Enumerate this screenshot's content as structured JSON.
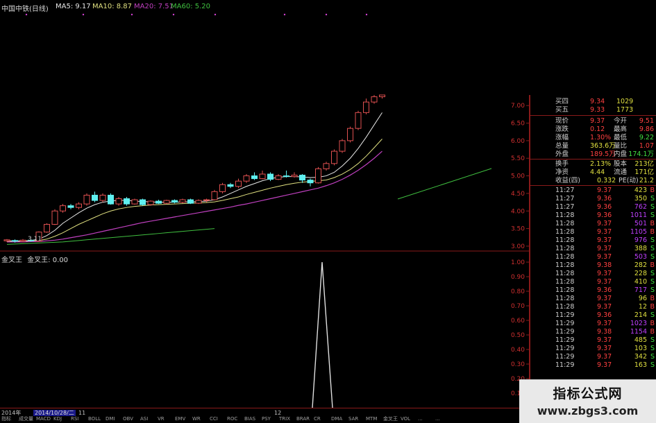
{
  "header": {
    "stock_name": "中国中铁(日线)",
    "ma5": "MA5: 9.17",
    "ma10": "MA10: 8.87",
    "ma20": "MA20: 7.51",
    "ma60": "MA60: 5.20"
  },
  "indicator": {
    "label1": "金叉王",
    "label2": "金叉王: 0.00"
  },
  "axis": {
    "price_ticks": [
      "7.00",
      "6.50",
      "6.00",
      "5.50",
      "5.00",
      "4.50",
      "4.00",
      "3.50",
      "3.00"
    ],
    "ind_ticks": [
      "1.00",
      "0.90",
      "0.80",
      "0.70",
      "0.60",
      "0.50",
      "0.40",
      "0.30",
      "0.20",
      "0.10"
    ],
    "low_price_label": "3.11"
  },
  "bottom": {
    "year_tab": "2014年",
    "date_tab": "2014/10/28/二",
    "marker_a": "11",
    "marker_b": "12",
    "tabs": [
      "指标",
      "成交量",
      "MACD",
      "KDJ",
      "RSI",
      "BOLL",
      "DMI",
      "OBV",
      "ASI",
      "VR",
      "EMV",
      "WR",
      "CCI",
      "ROC",
      "BIAS",
      "PSY",
      "TRIX",
      "BRAR",
      "CR",
      "DMA",
      "SAR",
      "MTM",
      "金叉王",
      "VOL",
      "...",
      "..."
    ]
  },
  "quote_panel": {
    "buy_levels": [
      {
        "label": "买四",
        "price": "9.34",
        "volume": "1029"
      },
      {
        "label": "买五",
        "price": "9.33",
        "volume": "1773"
      }
    ],
    "stats": [
      {
        "l1": "现价",
        "v1": "9.37",
        "l2": "今开",
        "v2": "9.51"
      },
      {
        "l1": "涨跌",
        "v1": "0.12",
        "l2": "最高",
        "v2": "9.86"
      },
      {
        "l1": "涨幅",
        "v1": "1.30%",
        "l2": "最低",
        "v2": "9.22"
      },
      {
        "l1": "总量",
        "v1": "363.6万",
        "l2": "量比",
        "v2": "1.07"
      },
      {
        "l1": "外盘",
        "v1": "189.5万",
        "l2": "内盘",
        "v2": "174.1万"
      },
      {
        "l1": "换手",
        "v1": "2.13%",
        "l2": "股本",
        "v2": "213亿"
      },
      {
        "l1": "净资",
        "v1": "4.44",
        "l2": "流通",
        "v2": "171亿"
      },
      {
        "l1": "收益(四)",
        "v1": "0.332",
        "l2": "PE(动)",
        "v2": "21.2"
      }
    ],
    "trades": [
      {
        "time": "11:27",
        "price": "9.37",
        "vol": "423",
        "side": "B"
      },
      {
        "time": "11:27",
        "price": "9.36",
        "vol": "350",
        "side": "S"
      },
      {
        "time": "11:27",
        "price": "9.36",
        "vol": "762",
        "side": "S"
      },
      {
        "time": "11:28",
        "price": "9.36",
        "vol": "1011",
        "side": "S"
      },
      {
        "time": "11:28",
        "price": "9.37",
        "vol": "501",
        "side": "B"
      },
      {
        "time": "11:28",
        "price": "9.37",
        "vol": "1105",
        "side": "B"
      },
      {
        "time": "11:28",
        "price": "9.37",
        "vol": "976",
        "side": "S"
      },
      {
        "time": "11:28",
        "price": "9.37",
        "vol": "388",
        "side": "S"
      },
      {
        "time": "11:28",
        "price": "9.37",
        "vol": "503",
        "side": "S"
      },
      {
        "time": "11:28",
        "price": "9.38",
        "vol": "282",
        "side": "B"
      },
      {
        "time": "11:28",
        "price": "9.37",
        "vol": "228",
        "side": "S"
      },
      {
        "time": "11:28",
        "price": "9.37",
        "vol": "410",
        "side": "S"
      },
      {
        "time": "11:28",
        "price": "9.36",
        "vol": "717",
        "side": "S"
      },
      {
        "time": "11:28",
        "price": "9.37",
        "vol": "96",
        "side": "B"
      },
      {
        "time": "11:28",
        "price": "9.37",
        "vol": "12",
        "side": "B"
      },
      {
        "time": "11:29",
        "price": "9.36",
        "vol": "214",
        "side": "S"
      },
      {
        "time": "11:29",
        "price": "9.37",
        "vol": "1023",
        "side": "B"
      },
      {
        "time": "11:29",
        "price": "9.38",
        "vol": "1154",
        "side": "B"
      },
      {
        "time": "11:29",
        "price": "9.37",
        "vol": "485",
        "side": "S"
      },
      {
        "time": "11:29",
        "price": "9.37",
        "vol": "103",
        "side": "S"
      },
      {
        "time": "11:29",
        "price": "9.37",
        "vol": "342",
        "side": "S"
      },
      {
        "time": "11:29",
        "price": "9.37",
        "vol": "163",
        "side": "S"
      }
    ]
  },
  "watermark": {
    "line1": "指标公式网",
    "line2": "www.zbgs3.com"
  },
  "colors": {
    "up": "#e05050",
    "down": "#5ff0f0",
    "ma5": "#e8e8e8",
    "ma10": "#e0e080",
    "ma20": "#c040c0",
    "ma60": "#40c040",
    "panel_border": "#8a1a1a",
    "value_red": "#ff4040",
    "value_yellow": "#e0e040",
    "value_green": "#40e040",
    "value_purple": "#c040ff",
    "label_text": "#d0d0d0"
  },
  "chart_data": {
    "type": "candlestick",
    "ylim": [
      2.9,
      7.3
    ],
    "candles": [
      [
        3.15,
        3.18,
        3.12,
        3.2
      ],
      [
        3.16,
        3.14,
        3.1,
        3.19
      ],
      [
        3.14,
        3.17,
        3.11,
        3.2
      ],
      [
        3.17,
        3.15,
        3.13,
        3.19
      ],
      [
        3.14,
        3.4,
        3.12,
        3.42
      ],
      [
        3.4,
        3.62,
        3.38,
        3.65
      ],
      [
        3.62,
        4.0,
        3.6,
        4.05
      ],
      [
        4.0,
        4.15,
        3.95,
        4.2
      ],
      [
        4.15,
        4.1,
        4.05,
        4.2
      ],
      [
        4.1,
        4.2,
        4.05,
        4.25
      ],
      [
        4.2,
        4.45,
        4.15,
        4.5
      ],
      [
        4.45,
        4.3,
        4.25,
        4.55
      ],
      [
        4.3,
        4.45,
        4.25,
        4.5
      ],
      [
        4.45,
        4.2,
        4.18,
        4.5
      ],
      [
        4.2,
        4.35,
        4.15,
        4.4
      ],
      [
        4.35,
        4.2,
        4.15,
        4.4
      ],
      [
        4.2,
        4.32,
        4.18,
        4.35
      ],
      [
        4.32,
        4.18,
        4.15,
        4.35
      ],
      [
        4.18,
        4.28,
        4.15,
        4.3
      ],
      [
        4.28,
        4.22,
        4.2,
        4.32
      ],
      [
        4.22,
        4.3,
        4.2,
        4.32
      ],
      [
        4.3,
        4.25,
        4.22,
        4.33
      ],
      [
        4.25,
        4.32,
        4.22,
        4.35
      ],
      [
        4.32,
        4.22,
        4.2,
        4.35
      ],
      [
        4.22,
        4.3,
        4.2,
        4.33
      ],
      [
        4.3,
        4.32,
        4.25,
        4.35
      ],
      [
        4.32,
        4.55,
        4.3,
        4.6
      ],
      [
        4.55,
        4.75,
        4.5,
        4.8
      ],
      [
        4.75,
        4.7,
        4.65,
        4.8
      ],
      [
        4.7,
        4.85,
        4.65,
        4.92
      ],
      [
        4.85,
        5.0,
        4.8,
        5.05
      ],
      [
        5.0,
        4.92,
        4.88,
        5.1
      ],
      [
        4.92,
        5.05,
        4.9,
        5.15
      ],
      [
        5.05,
        4.9,
        4.85,
        5.1
      ],
      [
        4.9,
        5.0,
        4.88,
        5.05
      ],
      [
        5.0,
        4.98,
        4.95,
        5.15
      ],
      [
        4.98,
        5.02,
        4.95,
        5.1
      ],
      [
        5.02,
        4.88,
        4.8,
        5.05
      ],
      [
        4.88,
        4.8,
        4.7,
        4.92
      ],
      [
        4.8,
        5.2,
        4.78,
        5.25
      ],
      [
        5.2,
        5.35,
        5.15,
        5.4
      ],
      [
        5.35,
        5.7,
        5.3,
        5.75
      ],
      [
        5.7,
        6.0,
        5.65,
        6.05
      ],
      [
        6.0,
        6.35,
        5.95,
        6.4
      ],
      [
        6.35,
        6.8,
        6.3,
        6.85
      ],
      [
        6.8,
        7.1,
        6.75,
        7.2
      ],
      [
        7.1,
        7.25,
        7.05,
        7.3
      ],
      [
        7.25,
        7.3,
        7.2,
        7.3
      ]
    ],
    "ma5": [
      3.15,
      3.15,
      3.15,
      3.16,
      3.2,
      3.3,
      3.45,
      3.65,
      3.8,
      3.95,
      4.08,
      4.18,
      4.25,
      4.28,
      4.3,
      4.3,
      4.28,
      4.27,
      4.26,
      4.25,
      4.25,
      4.25,
      4.26,
      4.26,
      4.27,
      4.28,
      4.32,
      4.4,
      4.5,
      4.6,
      4.7,
      4.78,
      4.86,
      4.92,
      4.96,
      4.98,
      4.98,
      4.97,
      4.95,
      4.96,
      5.0,
      5.1,
      5.28,
      5.5,
      5.78,
      6.1,
      6.45,
      6.8
    ],
    "ma10": [
      3.14,
      3.14,
      3.14,
      3.15,
      3.16,
      3.2,
      3.28,
      3.38,
      3.5,
      3.62,
      3.72,
      3.82,
      3.92,
      4.0,
      4.06,
      4.1,
      4.13,
      4.15,
      4.17,
      4.18,
      4.19,
      4.2,
      4.21,
      4.22,
      4.23,
      4.24,
      4.26,
      4.3,
      4.35,
      4.4,
      4.47,
      4.53,
      4.59,
      4.65,
      4.7,
      4.75,
      4.79,
      4.82,
      4.84,
      4.86,
      4.88,
      4.95,
      5.05,
      5.18,
      5.35,
      5.56,
      5.8,
      6.05
    ],
    "ma20": [
      3.12,
      3.12,
      3.12,
      3.13,
      3.13,
      3.15,
      3.17,
      3.2,
      3.24,
      3.28,
      3.32,
      3.37,
      3.42,
      3.47,
      3.52,
      3.57,
      3.62,
      3.67,
      3.71,
      3.75,
      3.79,
      3.83,
      3.87,
      3.91,
      3.95,
      3.99,
      4.03,
      4.07,
      4.11,
      4.16,
      4.2,
      4.25,
      4.3,
      4.35,
      4.4,
      4.45,
      4.5,
      4.55,
      4.6,
      4.65,
      4.72,
      4.8,
      4.9,
      5.02,
      5.16,
      5.32,
      5.5,
      5.7
    ],
    "ma60": [
      3.05,
      3.06,
      3.07,
      3.08,
      3.09,
      3.1,
      3.11,
      3.12,
      3.14,
      3.16,
      3.18,
      3.2,
      3.22,
      3.24,
      3.26,
      3.28,
      3.3,
      3.32,
      3.34,
      3.36,
      3.38,
      3.4,
      3.42,
      3.44,
      3.46,
      3.48,
      3.5
    ]
  }
}
